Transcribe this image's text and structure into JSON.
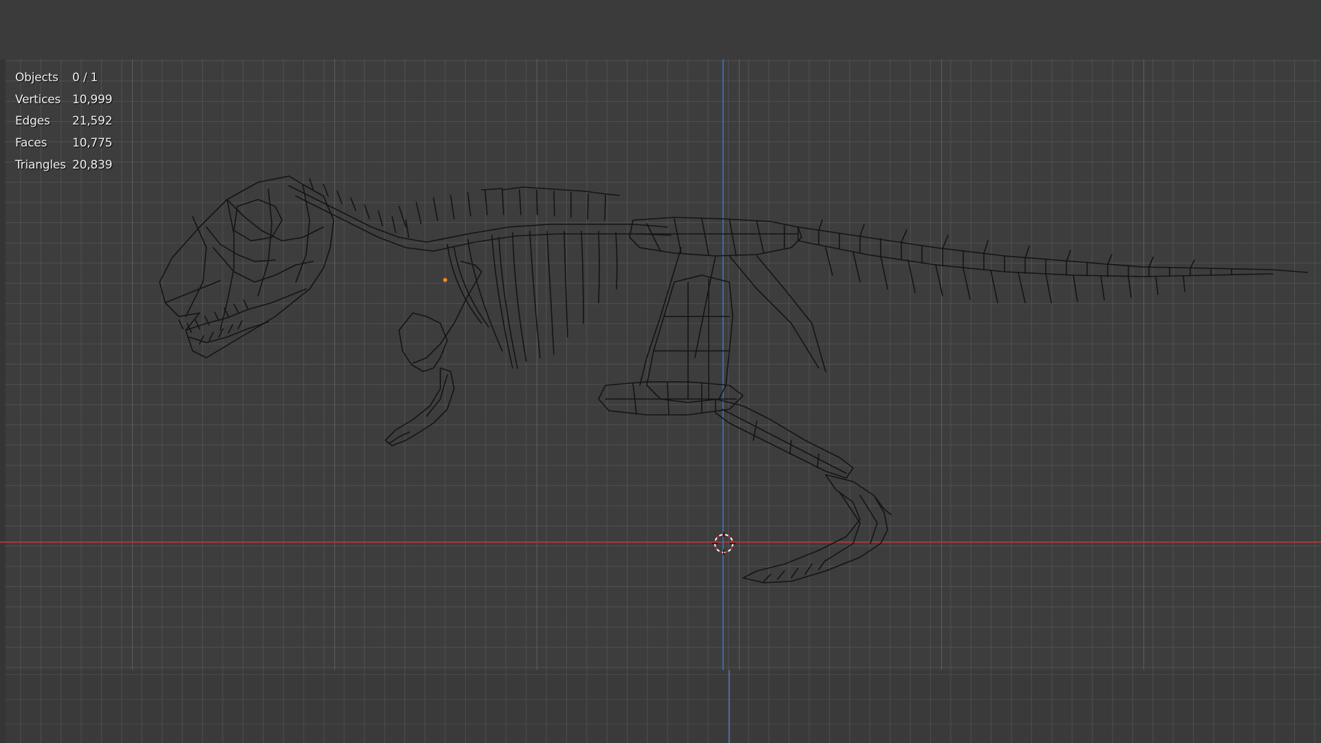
{
  "viewport": {
    "stats": [
      {
        "label": "Objects",
        "value": "0 / 1"
      },
      {
        "label": "Vertices",
        "value": "10,999"
      },
      {
        "label": "Edges",
        "value": "21,592"
      },
      {
        "label": "Faces",
        "value": "10,775"
      },
      {
        "label": "Triangles",
        "value": "20,839"
      }
    ],
    "colors": {
      "x_axis": "#a33a3e",
      "z_axis": "#3b6aa8",
      "wireframe": "#111111",
      "origin": "#f08a1c",
      "background": "#3d3d3d"
    },
    "icons": {
      "cursor": "3d-cursor-icon",
      "origin": "object-origin-icon"
    }
  }
}
